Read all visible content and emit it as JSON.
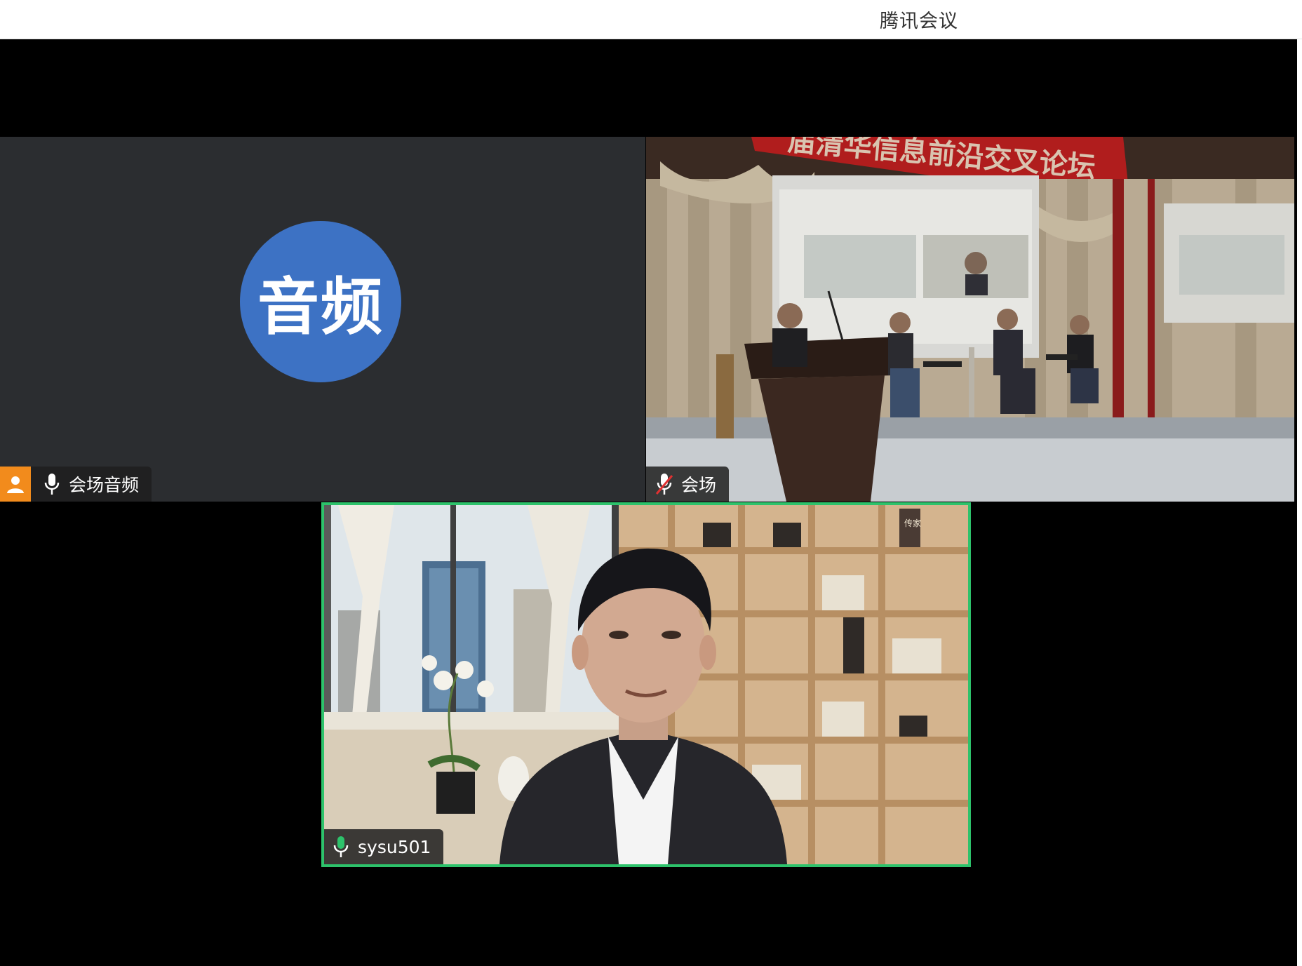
{
  "window": {
    "title": "腾讯会议"
  },
  "tiles": {
    "audio": {
      "avatar_text": "音频",
      "name": "会场音频",
      "avatar_color": "#3d72c4",
      "host_badge_color": "#f28b1c",
      "mic_state": "on"
    },
    "venue": {
      "name": "会场",
      "banner_text": "届清华信息前沿交叉论坛",
      "mic_state": "muted"
    },
    "speaker": {
      "name": "sysu501",
      "mic_state": "speaking",
      "active_speaker_border_color": "#2dc26b",
      "book_spine_text": "传家"
    }
  },
  "icons": {
    "host": "person-icon",
    "mic": "microphone-icon",
    "mic_muted": "microphone-muted-icon",
    "mic_active": "microphone-active-icon"
  }
}
